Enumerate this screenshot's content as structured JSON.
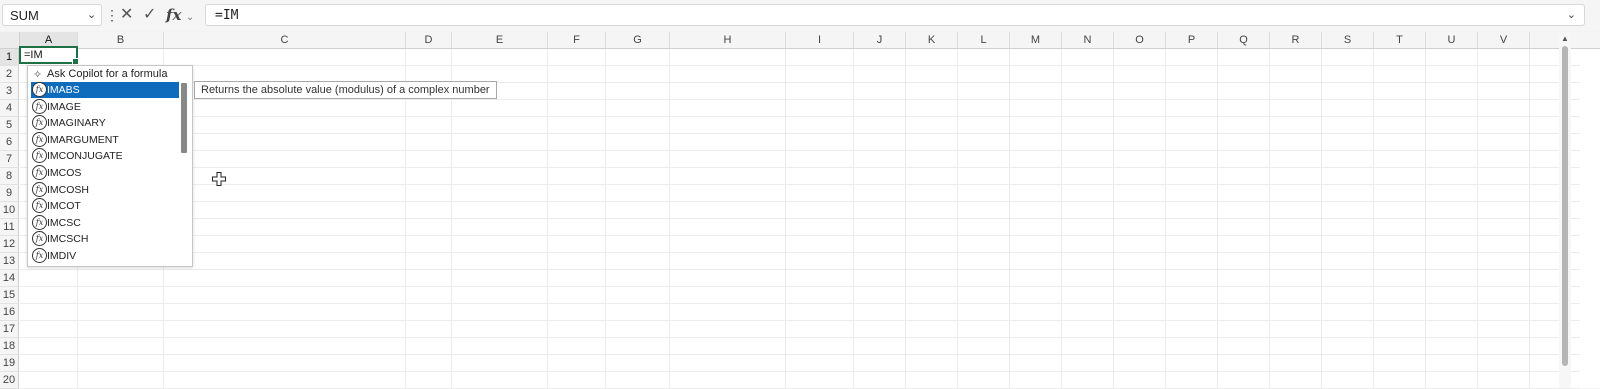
{
  "name_box": {
    "value": "SUM",
    "chevron_icon": "chevron-down-icon"
  },
  "formula_bar": {
    "more_icon": "vertical-ellipsis-icon",
    "cancel_icon": "close-icon",
    "enter_icon": "checkmark-icon",
    "fx_label": "fx",
    "fx_chevron": "chevron-down-icon",
    "value": "=IM",
    "expand_icon": "chevron-down-icon"
  },
  "columns": [
    "A",
    "B",
    "C",
    "D",
    "E",
    "F",
    "G",
    "H",
    "I",
    "J",
    "K",
    "L",
    "M",
    "N",
    "O",
    "P",
    "Q",
    "R",
    "S",
    "T",
    "U",
    "V"
  ],
  "rows": [
    "1",
    "2",
    "3",
    "4",
    "5",
    "6",
    "7",
    "8",
    "9",
    "10",
    "11",
    "12",
    "13",
    "14",
    "15",
    "16",
    "17",
    "18",
    "19",
    "20"
  ],
  "active_cell": {
    "column": "A",
    "row": "1",
    "value": "=IM"
  },
  "autocomplete": {
    "copilot_label": "Ask Copilot for a formula",
    "copilot_icon": "sparkle-icon",
    "item_icon": "function-icon",
    "fx_glyph": "fx",
    "selected_index": 0,
    "items": [
      "IMABS",
      "IMAGE",
      "IMAGINARY",
      "IMARGUMENT",
      "IMCONJUGATE",
      "IMCOS",
      "IMCOSH",
      "IMCOT",
      "IMCSC",
      "IMCSCH",
      "IMDIV"
    ]
  },
  "tooltip": {
    "text": "Returns the absolute value (modulus) of a complex number"
  },
  "colors": {
    "accent_green": "#1e7145",
    "selection_blue": "#0f6cbd"
  }
}
